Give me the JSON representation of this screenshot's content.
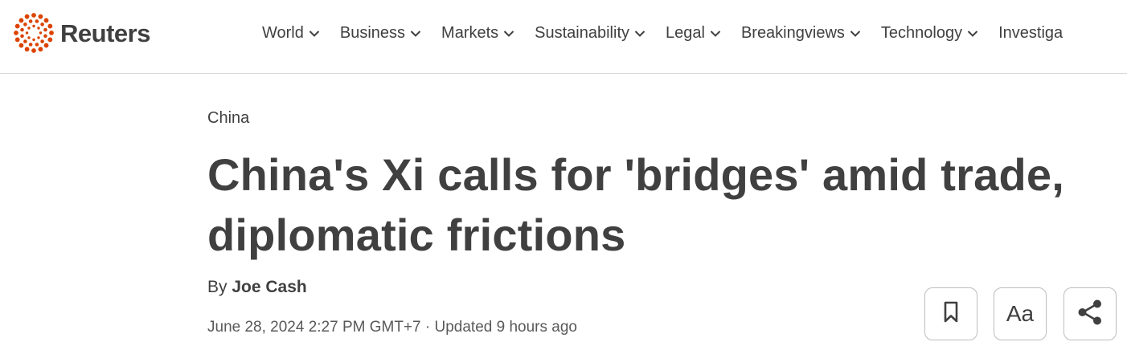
{
  "brand": {
    "name": "Reuters",
    "accent_color": "#dc4300"
  },
  "nav": {
    "items": [
      {
        "label": "World",
        "icon": "chevron-down-icon"
      },
      {
        "label": "Business",
        "icon": "chevron-down-icon"
      },
      {
        "label": "Markets",
        "icon": "chevron-down-icon"
      },
      {
        "label": "Sustainability",
        "icon": "chevron-down-icon"
      },
      {
        "label": "Legal",
        "icon": "chevron-down-icon"
      },
      {
        "label": "Breakingviews",
        "icon": "chevron-down-icon"
      },
      {
        "label": "Technology",
        "icon": "chevron-down-icon"
      },
      {
        "label": "Investiga",
        "icon": ""
      }
    ]
  },
  "article": {
    "section": "China",
    "headline": "China's Xi calls for 'bridges' amid trade, diplomatic frictions",
    "byline_prefix": "By",
    "author": "Joe Cash",
    "date": "June 28, 2024 2:27 PM GMT+7 · Updated 9 hours ago"
  },
  "tools": {
    "bookmark_icon": "bookmark-icon",
    "font_size_label": "Aa",
    "share_icon": "share-icon"
  }
}
